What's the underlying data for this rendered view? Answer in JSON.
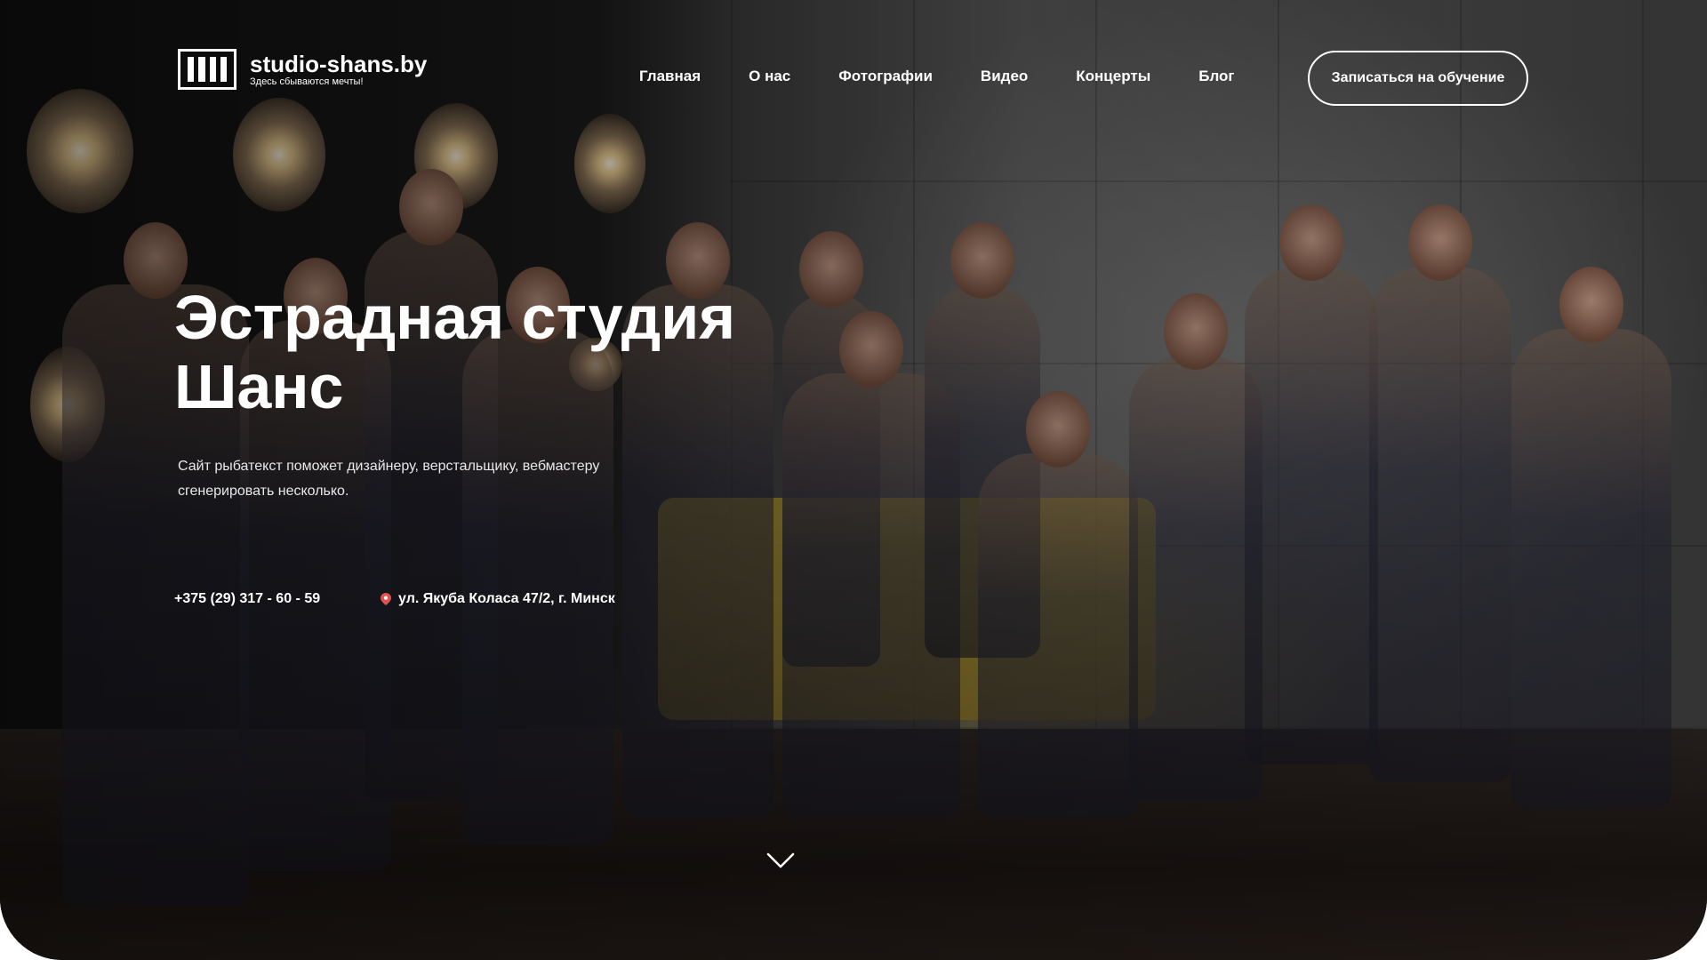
{
  "brand": {
    "title": "studio-shans.by",
    "slogan": "Здесь сбываются мечты!",
    "logo_icon": "piano-keys-logo-icon"
  },
  "nav": {
    "items": [
      {
        "label": "Главная"
      },
      {
        "label": "О нас"
      },
      {
        "label": "Фотографии"
      },
      {
        "label": "Видео"
      },
      {
        "label": "Концерты"
      },
      {
        "label": "Блог"
      }
    ]
  },
  "header": {
    "cta_label": "Записаться на обучение"
  },
  "hero": {
    "title_line1": "Эстрадная студия",
    "title_line2": "Шанс",
    "subtitle": "Сайт рыбатекст поможет дизайнеру, верстальщику, вебмастеру сгенерировать несколько.",
    "phone": "+375 (29) 317 - 60 - 59",
    "address": "ул. Якуба Коласа 47/2,  г. Минск",
    "address_icon": "map-pin-icon",
    "scroll_icon": "chevron-down-icon"
  },
  "colors": {
    "text": "#ffffff",
    "pin": "#e0524f"
  }
}
